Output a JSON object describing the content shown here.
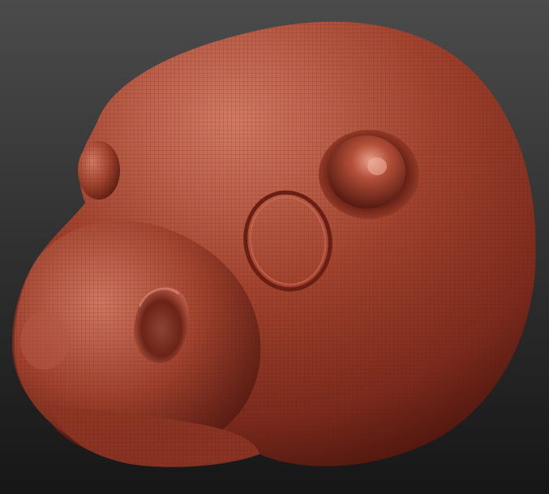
{
  "viewport": {
    "background_top": "#4b4b4b",
    "background_bottom": "#161616"
  },
  "model": {
    "material_base": "#a2432e",
    "material_highlight": "#d27a63",
    "material_shadow": "#4a140d",
    "wireframe": "#5a1b12"
  },
  "icons": {
    "head": "sculpt-head-icon"
  }
}
